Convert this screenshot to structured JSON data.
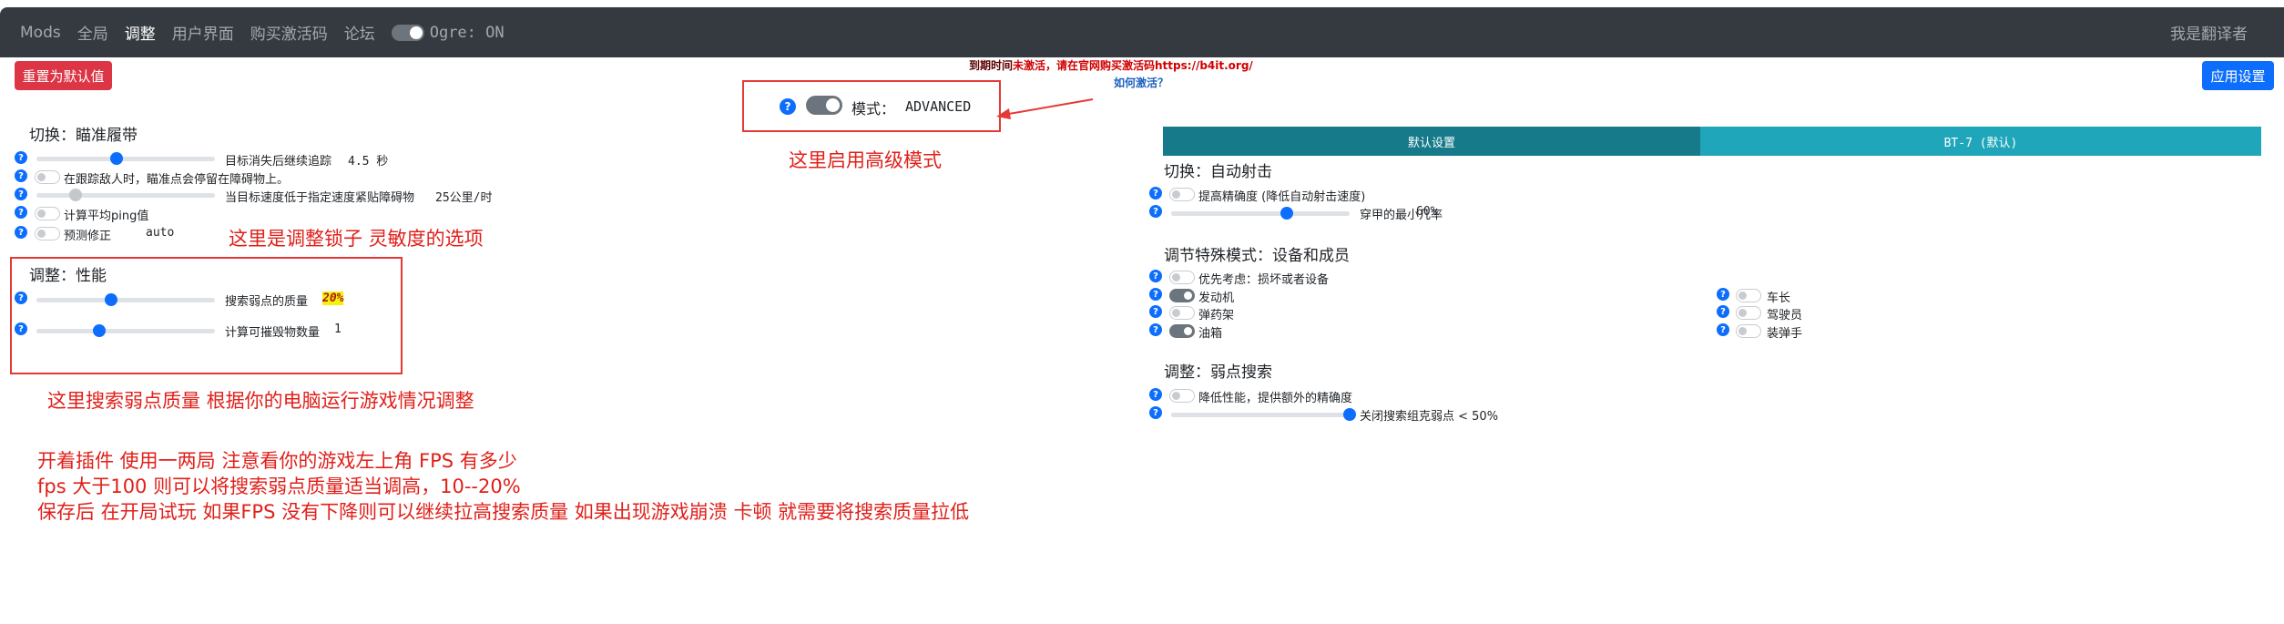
{
  "nav": {
    "items": [
      "Mods",
      "全局",
      "调整",
      "用户界面",
      "购买激活码",
      "论坛"
    ],
    "toggle_label": "Ogre: ON",
    "right_text": "我是翻译者"
  },
  "buttons": {
    "reset": "重置为默认值",
    "apply": "应用设置"
  },
  "mode": {
    "label": "模式：",
    "value": "ADVANCED",
    "enabled": true
  },
  "activation": {
    "line1_prefix": "到期时间",
    "line1_highlight": "未激活，请在官网购买激活码https://b4it.org/",
    "line2": "如何激活？"
  },
  "left": {
    "aim_title": "切换：瞄准履带",
    "aim_items": [
      {
        "type": "slider",
        "label": "目标消失后继续追踪",
        "value": "4.5 秒",
        "level": 0.45
      },
      {
        "type": "toggle",
        "label": "在跟踪敌人时，瞄准点会停留在障碍物上。",
        "on": false
      },
      {
        "type": "slider",
        "label": "当目标速度低于指定速度紧贴障碍物",
        "value": "25公里/时",
        "level": 0.22
      },
      {
        "type": "toggle",
        "label": "计算平均ping值",
        "on": false
      },
      {
        "type": "toggle",
        "label": "预测修正",
        "value": "auto",
        "on": false
      }
    ],
    "perf_title": "调整：性能",
    "perf_items": [
      {
        "label": "搜索弱点的质量",
        "value": "20%",
        "level": 0.42
      },
      {
        "label": "计算可摧毁物数量",
        "value": "1",
        "level": 0.35
      }
    ]
  },
  "right": {
    "tabs": [
      "默认设置",
      "BT-7 (默认)"
    ],
    "auto_title": "切换：自动射击",
    "auto_toggle": "提高精确度 (降低自动射击速度)",
    "auto_slider": {
      "label": "穿甲的最小几率",
      "value": "60%",
      "level": 0.65
    },
    "special_title": "调节特殊模式：设备和成员",
    "special_top": "优先考虑：损坏或者设备",
    "devices": [
      {
        "label": "发动机",
        "on": true
      },
      {
        "label": "弹药架",
        "on": false
      },
      {
        "label": "油箱",
        "on": true
      }
    ],
    "crew": [
      {
        "label": "车长",
        "on": false
      },
      {
        "label": "驾驶员",
        "on": false
      },
      {
        "label": "装弹手",
        "on": false
      }
    ],
    "weak_title": "调整：弱点搜索",
    "weak_toggle": "降低性能，提供额外的精确度",
    "weak_slider": {
      "label": "关闭搜索组克弱点 < 50%",
      "level": 1.0
    }
  },
  "annotations": {
    "mode_note": "这里启用高级模式",
    "aim_note": "这里是调整锁子 灵敏度的选项",
    "perf_note": "这里搜索弱点质量 根据你的电脑运行游戏情况调整",
    "tips": [
      "开着插件 使用一两局 注意看你的游戏左上角 FPS 有多少",
      "fps 大于100 则可以将搜索弱点质量适当调高，10--20%",
      "保存后 在开局试玩 如果FPS 没有下降则可以继续拉高搜索质量 如果出现游戏崩溃 卡顿 就需要将搜索质量拉低"
    ]
  },
  "colors": {
    "nav_bg": "#343a40",
    "tab_active": "#167a8a",
    "tab_inactive": "#1fa6bb",
    "annotation_red": "#e0201a",
    "primary": "#0d6efd",
    "danger": "#dc3545"
  }
}
